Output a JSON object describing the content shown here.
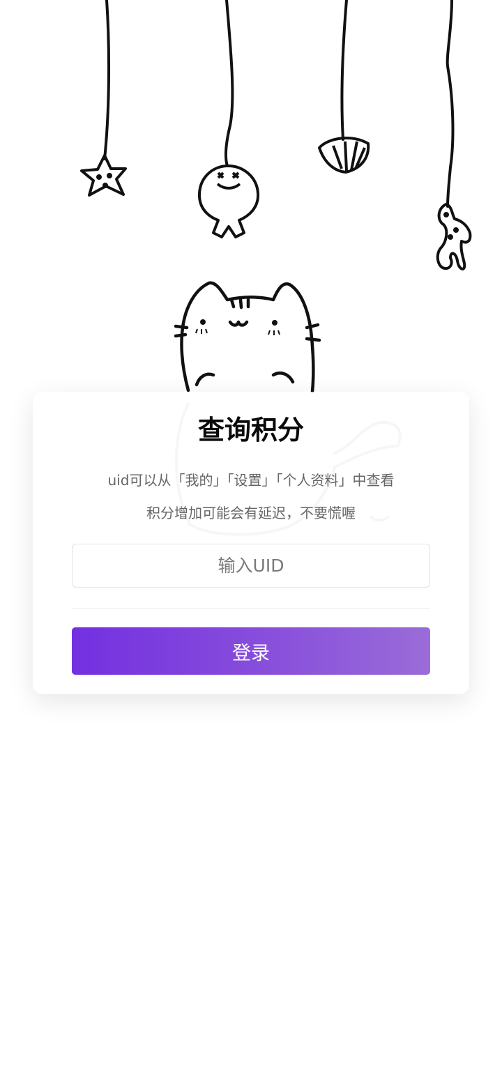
{
  "card": {
    "title": "查询积分",
    "hint_line_1": "uid可以从「我的」「设置」「个人资料」中查看",
    "hint_line_2": "积分增加可能会有延迟，不要慌喔"
  },
  "uid_input": {
    "placeholder": "输入UID",
    "value": ""
  },
  "login_button": {
    "label": "登录"
  },
  "colors": {
    "button_gradient_start": "#7330e0",
    "button_gradient_end": "#9a6cd8",
    "title": "#0a0a0a",
    "hint": "#666666",
    "background": "#ffffff"
  },
  "illustration": {
    "hanging_items": [
      "starfish-icon",
      "fish-icon",
      "seashell-icon",
      "coral-icon"
    ],
    "character": "cat-icon"
  }
}
